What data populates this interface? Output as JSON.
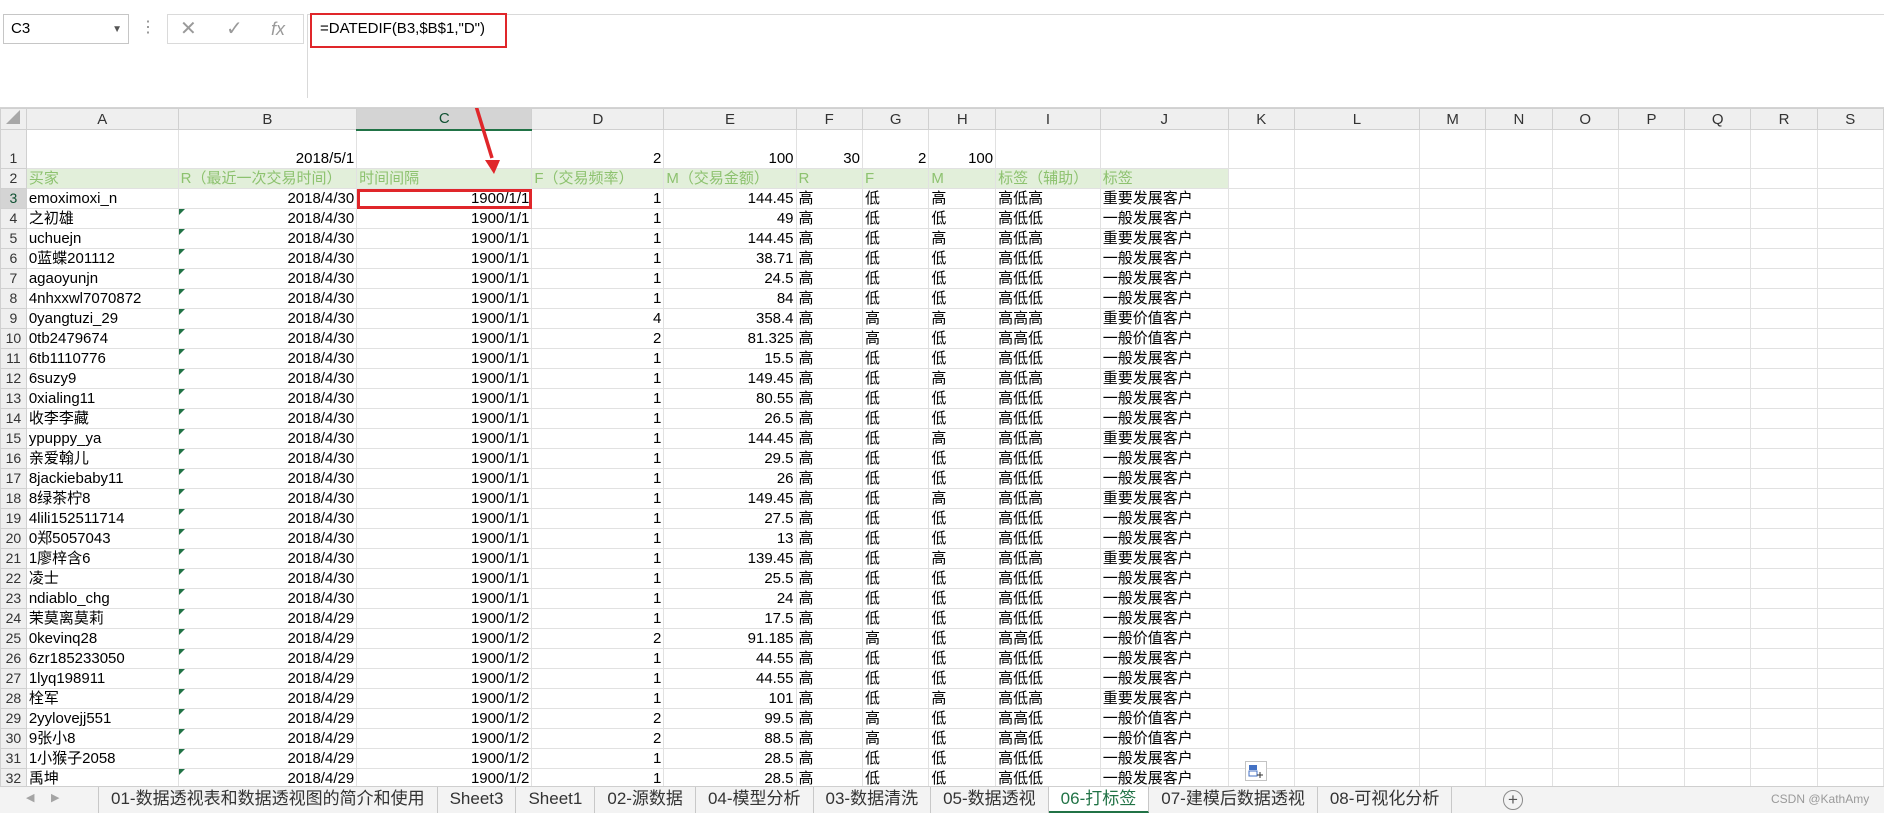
{
  "namebox": {
    "value": "C3"
  },
  "formula": {
    "cancel_icon": "✕",
    "enter_icon": "✓",
    "fx_label": "fx",
    "text": "=DATEDIF(B3,$B$1,\"D\")"
  },
  "columns": [
    "A",
    "B",
    "C",
    "D",
    "E",
    "F",
    "G",
    "H",
    "I",
    "J",
    "K",
    "L",
    "M",
    "N",
    "O",
    "P",
    "Q",
    "R",
    "S"
  ],
  "row1": {
    "B": "2018/5/1",
    "D": "2",
    "E": "100",
    "F": "30",
    "G": "2",
    "H": "100"
  },
  "header_row": [
    "买家",
    "R（最近一次交易时间）",
    "时间间隔",
    "F（交易频率）",
    "M（交易金额）",
    "R",
    "F",
    "M",
    "标签（辅助）",
    "标签"
  ],
  "rows": [
    [
      "emoximoxi_n",
      "2018/4/30",
      "1900/1/1",
      "1",
      "144.45",
      "高",
      "低",
      "高",
      "高低高",
      "重要发展客户"
    ],
    [
      "之初雄",
      "2018/4/30",
      "1900/1/1",
      "1",
      "49",
      "高",
      "低",
      "低",
      "高低低",
      "一般发展客户"
    ],
    [
      "uchuejn",
      "2018/4/30",
      "1900/1/1",
      "1",
      "144.45",
      "高",
      "低",
      "高",
      "高低高",
      "重要发展客户"
    ],
    [
      "0蓝蝶201112",
      "2018/4/30",
      "1900/1/1",
      "1",
      "38.71",
      "高",
      "低",
      "低",
      "高低低",
      "一般发展客户"
    ],
    [
      "agaoyunjn",
      "2018/4/30",
      "1900/1/1",
      "1",
      "24.5",
      "高",
      "低",
      "低",
      "高低低",
      "一般发展客户"
    ],
    [
      "4nhxxwl7070872",
      "2018/4/30",
      "1900/1/1",
      "1",
      "84",
      "高",
      "低",
      "低",
      "高低低",
      "一般发展客户"
    ],
    [
      "0yangtuzi_29",
      "2018/4/30",
      "1900/1/1",
      "4",
      "358.4",
      "高",
      "高",
      "高",
      "高高高",
      "重要价值客户"
    ],
    [
      "0tb2479674",
      "2018/4/30",
      "1900/1/1",
      "2",
      "81.325",
      "高",
      "高",
      "低",
      "高高低",
      "一般价值客户"
    ],
    [
      "6tb1110776",
      "2018/4/30",
      "1900/1/1",
      "1",
      "15.5",
      "高",
      "低",
      "低",
      "高低低",
      "一般发展客户"
    ],
    [
      "6suzy9",
      "2018/4/30",
      "1900/1/1",
      "1",
      "149.45",
      "高",
      "低",
      "高",
      "高低高",
      "重要发展客户"
    ],
    [
      "0xialing11",
      "2018/4/30",
      "1900/1/1",
      "1",
      "80.55",
      "高",
      "低",
      "低",
      "高低低",
      "一般发展客户"
    ],
    [
      "收李李藏",
      "2018/4/30",
      "1900/1/1",
      "1",
      "26.5",
      "高",
      "低",
      "低",
      "高低低",
      "一般发展客户"
    ],
    [
      "ypuppy_ya",
      "2018/4/30",
      "1900/1/1",
      "1",
      "144.45",
      "高",
      "低",
      "高",
      "高低高",
      "重要发展客户"
    ],
    [
      "亲爱翰儿",
      "2018/4/30",
      "1900/1/1",
      "1",
      "29.5",
      "高",
      "低",
      "低",
      "高低低",
      "一般发展客户"
    ],
    [
      "8jackiebaby11",
      "2018/4/30",
      "1900/1/1",
      "1",
      "26",
      "高",
      "低",
      "低",
      "高低低",
      "一般发展客户"
    ],
    [
      "8绿茶柠8",
      "2018/4/30",
      "1900/1/1",
      "1",
      "149.45",
      "高",
      "低",
      "高",
      "高低高",
      "重要发展客户"
    ],
    [
      "4lili152511714",
      "2018/4/30",
      "1900/1/1",
      "1",
      "27.5",
      "高",
      "低",
      "低",
      "高低低",
      "一般发展客户"
    ],
    [
      "0郑5057043",
      "2018/4/30",
      "1900/1/1",
      "1",
      "13",
      "高",
      "低",
      "低",
      "高低低",
      "一般发展客户"
    ],
    [
      "1廖梓含6",
      "2018/4/30",
      "1900/1/1",
      "1",
      "139.45",
      "高",
      "低",
      "高",
      "高低高",
      "重要发展客户"
    ],
    [
      "凌士",
      "2018/4/30",
      "1900/1/1",
      "1",
      "25.5",
      "高",
      "低",
      "低",
      "高低低",
      "一般发展客户"
    ],
    [
      "ndiablo_chg",
      "2018/4/30",
      "1900/1/1",
      "1",
      "24",
      "高",
      "低",
      "低",
      "高低低",
      "一般发展客户"
    ],
    [
      "茉莫离莫莉",
      "2018/4/29",
      "1900/1/2",
      "1",
      "17.5",
      "高",
      "低",
      "低",
      "高低低",
      "一般发展客户"
    ],
    [
      "0kevinq28",
      "2018/4/29",
      "1900/1/2",
      "2",
      "91.185",
      "高",
      "高",
      "低",
      "高高低",
      "一般价值客户"
    ],
    [
      "6zr185233050",
      "2018/4/29",
      "1900/1/2",
      "1",
      "44.55",
      "高",
      "低",
      "低",
      "高低低",
      "一般发展客户"
    ],
    [
      "1lyq198911",
      "2018/4/29",
      "1900/1/2",
      "1",
      "44.55",
      "高",
      "低",
      "低",
      "高低低",
      "一般发展客户"
    ],
    [
      "栓军",
      "2018/4/29",
      "1900/1/2",
      "1",
      "101",
      "高",
      "低",
      "高",
      "高低高",
      "重要发展客户"
    ],
    [
      "2yylovejj551",
      "2018/4/29",
      "1900/1/2",
      "2",
      "99.5",
      "高",
      "高",
      "低",
      "高高低",
      "一般价值客户"
    ],
    [
      "9张小8",
      "2018/4/29",
      "1900/1/2",
      "2",
      "88.5",
      "高",
      "高",
      "低",
      "高高低",
      "一般价值客户"
    ],
    [
      "1小猴子2058",
      "2018/4/29",
      "1900/1/2",
      "1",
      "28.5",
      "高",
      "低",
      "低",
      "高低低",
      "一般发展客户"
    ],
    [
      "禹坤",
      "2018/4/29",
      "1900/1/2",
      "1",
      "28.5",
      "高",
      "低",
      "低",
      "高低低",
      "一般发展客户"
    ]
  ],
  "tabs": [
    "01-数据透视表和数据透视图的简介和使用",
    "Sheet3",
    "Sheet1",
    "02-源数据",
    "04-模型分析",
    "03-数据清洗",
    "05-数据透视",
    "06-打标签",
    "07-建模后数据透视",
    "08-可视化分析"
  ],
  "active_tab": "06-打标签",
  "tab_nav": {
    "prev_icon": "◀",
    "next_icon": "▶"
  },
  "add_sheet_icon": "+",
  "watermark": "CSDN @KathAmy",
  "colors": {
    "accent": "#217346",
    "highlight": "#e0262a",
    "header_fill": "#e2efda",
    "header_text": "#8dc26f"
  }
}
